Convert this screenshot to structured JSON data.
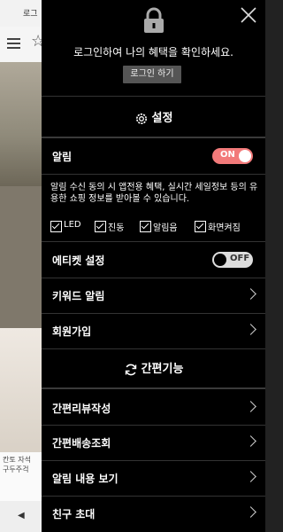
{
  "background": {
    "top_text": "로그",
    "caption_line1": "칸토 자석",
    "caption_line2": "구두주걱"
  },
  "drawer": {
    "login_message": "로그인하여 나의 혜택을 확인하세요.",
    "login_button": "로그인 하기",
    "settings_title": "설정",
    "notifications": {
      "label": "알림",
      "toggle": "ON",
      "enabled": true,
      "description": "알림 수신 동의 시 앱전용 혜택, 실시간 세일정보 등의 유용한 쇼핑 정보를 받아볼 수 있습니다.",
      "options": [
        {
          "label": "LED",
          "checked": true
        },
        {
          "label": "진동",
          "checked": true
        },
        {
          "label": "알림음",
          "checked": true
        },
        {
          "label": "화면켜짐",
          "checked": true
        }
      ]
    },
    "etiquette": {
      "label": "에티켓 설정",
      "toggle": "OFF",
      "enabled": false
    },
    "keyword_alert": "키워드 알림",
    "signup": "회원가입",
    "quick_title": "간편기능",
    "quick_items": [
      "간편리뷰작성",
      "간편배송조회",
      "알림 내용 보기",
      "친구 초대"
    ]
  },
  "colors": {
    "accent": "#f27a7a",
    "drawer_bg": "#000000"
  }
}
